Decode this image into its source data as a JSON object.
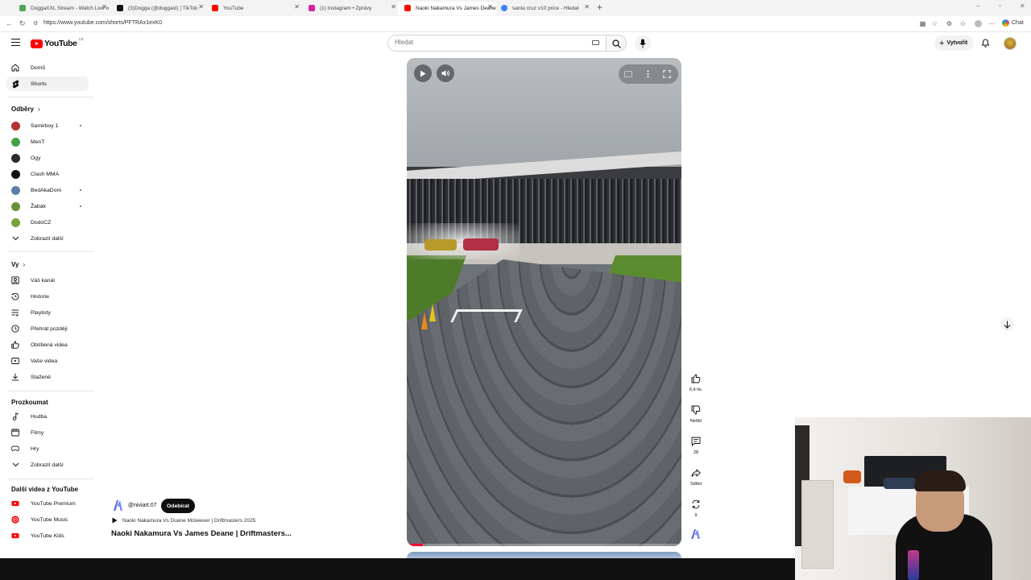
{
  "browser": {
    "tabs": [
      {
        "label": "DoggaXXL Stream - Watch Live o",
        "favicon_color": "#53a653"
      },
      {
        "label": "(3)Dogga (@doggaxl) | TikTok",
        "favicon_color": "#111111"
      },
      {
        "label": "YouTube",
        "favicon_color": "#ff0000"
      },
      {
        "label": "(1) Instagram • Zprávy",
        "favicon_color": "#d6249f"
      },
      {
        "label": "Naoki Nakamura Vs James Deane",
        "favicon_color": "#ff0000"
      },
      {
        "label": "santa cruz v10 price - Hledat",
        "favicon_color": "#3b82f6"
      }
    ],
    "url": "https://www.youtube.com/shorts/PFTRAx1exK0",
    "chat_label": "Chat"
  },
  "header": {
    "logo_text": "YouTube",
    "logo_region": "CZ",
    "search_placeholder": "Hledat",
    "create_label": "Vytvořit"
  },
  "sidebar": {
    "main": [
      {
        "label": "Domů",
        "icon": "home-icon"
      },
      {
        "label": "Shorts",
        "icon": "shorts-icon"
      }
    ],
    "subs_header": "Odběry",
    "subscriptions": [
      {
        "label": "Samirboy 1",
        "avatar_color": "#b4322f",
        "new": true
      },
      {
        "label": "MenT",
        "avatar_color": "#43a047",
        "new": false
      },
      {
        "label": "Ogy",
        "avatar_color": "#2b2b2b",
        "new": false
      },
      {
        "label": "Clash MMA",
        "avatar_color": "#111111",
        "new": false
      },
      {
        "label": "BedAkaDom",
        "avatar_color": "#5b7fa8",
        "new": true
      },
      {
        "label": "Žabák",
        "avatar_color": "#6a8f3a",
        "new": true
      },
      {
        "label": "DodoCZ",
        "avatar_color": "#7aa23a",
        "new": false
      }
    ],
    "subs_more": "Zobrazit další",
    "you_header": "Vy",
    "you": [
      {
        "label": "Váš kanál",
        "icon": "channel-icon"
      },
      {
        "label": "Historie",
        "icon": "history-icon"
      },
      {
        "label": "Playlisty",
        "icon": "playlists-icon"
      },
      {
        "label": "Přehrát později",
        "icon": "watch-later-icon"
      },
      {
        "label": "Oblíbená videa",
        "icon": "liked-videos-icon"
      },
      {
        "label": "Vaše videa",
        "icon": "your-videos-icon"
      },
      {
        "label": "Stažené",
        "icon": "downloads-icon"
      }
    ],
    "explore_header": "Prozkoumat",
    "explore": [
      {
        "label": "Hudba",
        "icon": "music-icon"
      },
      {
        "label": "Filmy",
        "icon": "movies-icon"
      },
      {
        "label": "Hry",
        "icon": "gaming-icon"
      }
    ],
    "explore_more": "Zobrazit další",
    "more_header": "Další videa z YouTube",
    "more": [
      {
        "label": "YouTube Premium",
        "color": "#ff0000"
      },
      {
        "label": "YouTube Music",
        "color": "#ff0000"
      },
      {
        "label": "YouTube Kids",
        "color": "#ff0000"
      }
    ]
  },
  "short": {
    "channel": "@niviart.07",
    "subscribe_label": "Odebírat",
    "sound": "Naoki Nakamura Vs Duane Mckeever  | Driftmasters 2025",
    "title": "Naoki Nakamura Vs James Deane | Driftmasters...",
    "progress": 0.06
  },
  "actions": {
    "like_count": "6,4 tis.",
    "dislike_label": "Nelíbí",
    "comments_count": "28",
    "share_label": "Sdílet",
    "remix_count": "9"
  },
  "colors": {
    "brand_red": "#ff0000",
    "subscribe_bg": "#0f0f0f"
  }
}
